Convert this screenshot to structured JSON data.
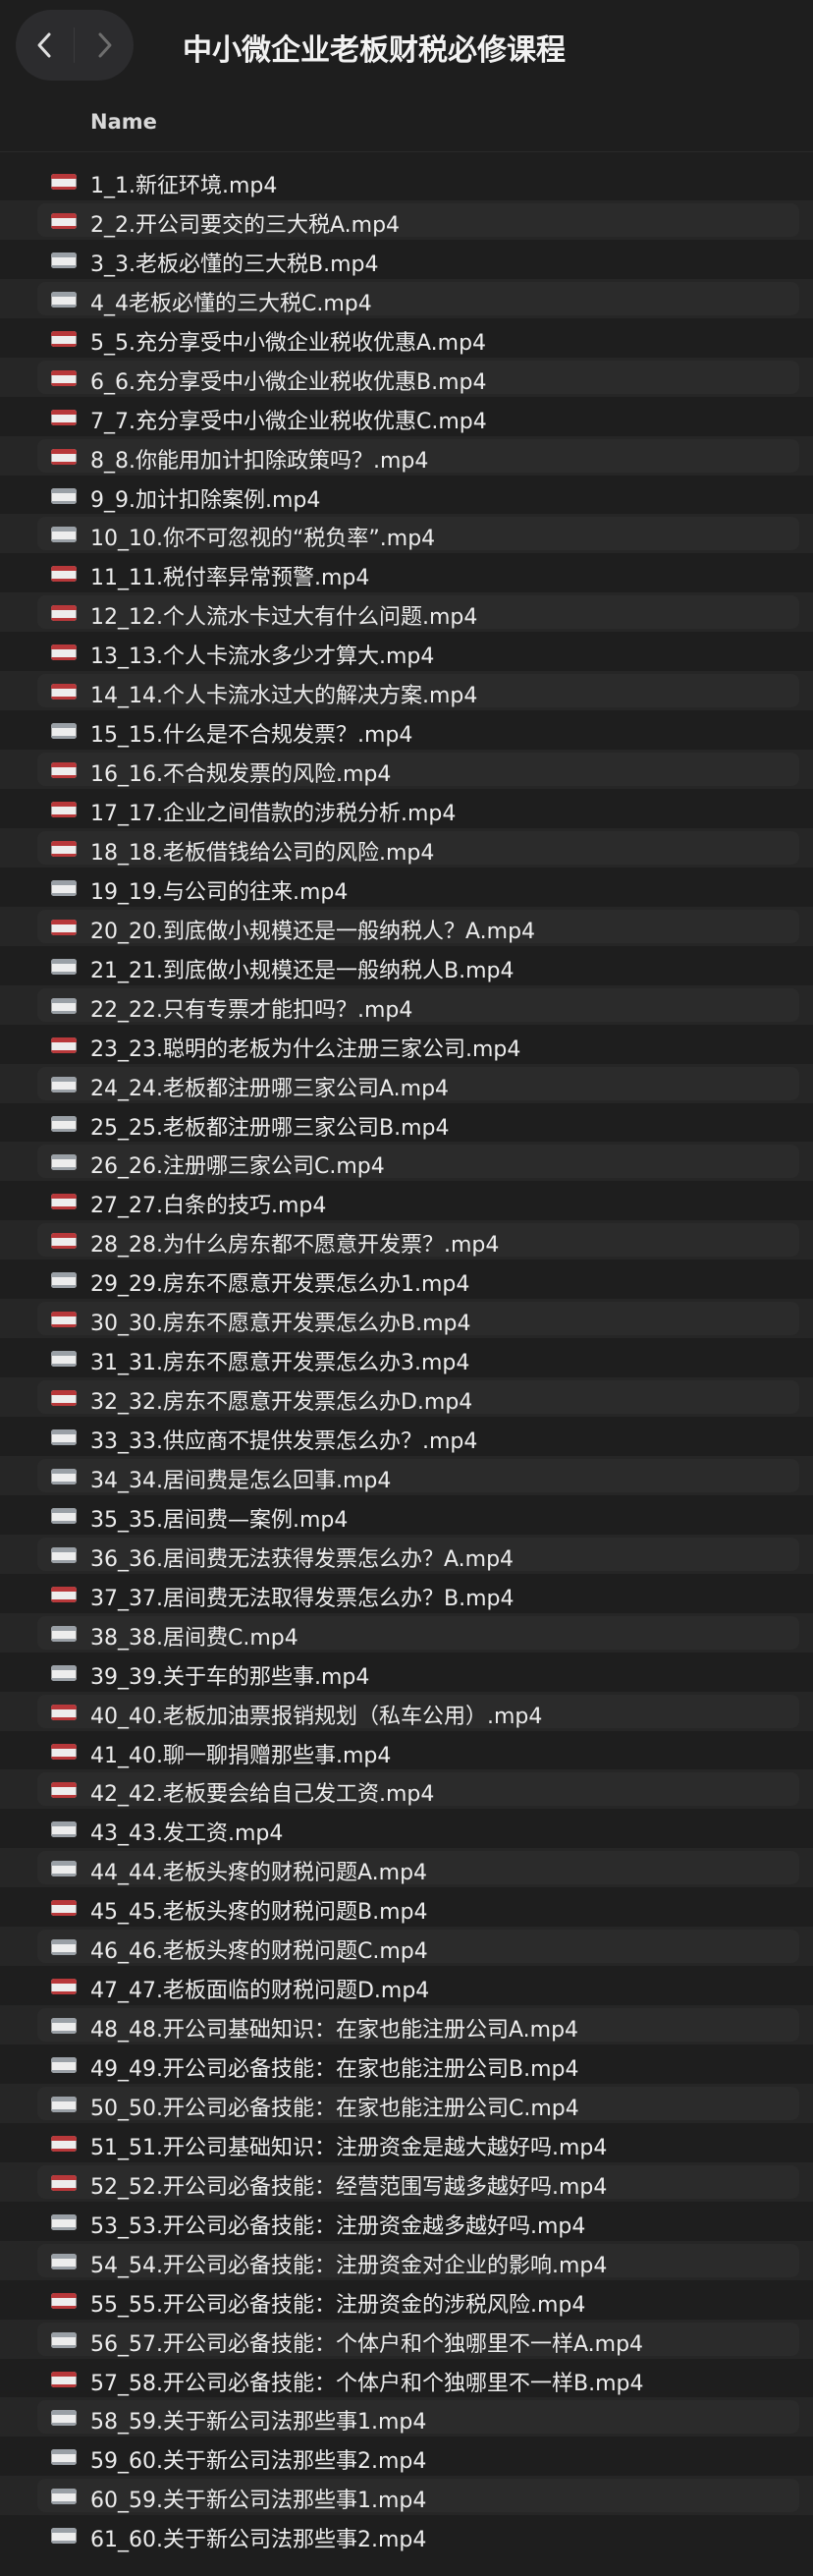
{
  "window": {
    "title": "中小微企业老板财税必修课程"
  },
  "nav": {
    "back_icon": "chevron-left-icon",
    "forward_icon": "chevron-right-icon"
  },
  "columns": {
    "name": "Name"
  },
  "files": [
    {
      "name": "1_1.新征环境.mp4",
      "icon": "video-file-icon"
    },
    {
      "name": "2_2.开公司要交的三大税A.mp4",
      "icon": "video-file-icon"
    },
    {
      "name": "3_3.老板必懂的三大税B.mp4",
      "icon": "video-file-icon"
    },
    {
      "name": "4_4老板必懂的三大税C.mp4",
      "icon": "video-file-icon"
    },
    {
      "name": "5_5.充分享受中小微企业税收优惠A.mp4",
      "icon": "video-file-icon"
    },
    {
      "name": "6_6.充分享受中小微企业税收优惠B.mp4",
      "icon": "video-file-icon"
    },
    {
      "name": "7_7.充分享受中小微企业税收优惠C.mp4",
      "icon": "video-file-icon"
    },
    {
      "name": "8_8.你能用加计扣除政策吗？.mp4",
      "icon": "video-file-icon"
    },
    {
      "name": "9_9.加计扣除案例.mp4",
      "icon": "video-file-icon"
    },
    {
      "name": "10_10.你不可忽视的“税负率”.mp4",
      "icon": "video-file-icon"
    },
    {
      "name": "11_11.税付率异常预警.mp4",
      "icon": "video-file-icon"
    },
    {
      "name": "12_12.个人流水卡过大有什么问题.mp4",
      "icon": "video-file-icon"
    },
    {
      "name": "13_13.个人卡流水多少才算大.mp4",
      "icon": "video-file-icon"
    },
    {
      "name": "14_14.个人卡流水过大的解决方案.mp4",
      "icon": "video-file-icon"
    },
    {
      "name": "15_15.什么是不合规发票？.mp4",
      "icon": "video-file-icon"
    },
    {
      "name": "16_16.不合规发票的风险.mp4",
      "icon": "video-file-icon"
    },
    {
      "name": "17_17.企业之间借款的涉税分析.mp4",
      "icon": "video-file-icon"
    },
    {
      "name": "18_18.老板借钱给公司的风险.mp4",
      "icon": "video-file-icon"
    },
    {
      "name": "19_19.与公司的往来.mp4",
      "icon": "video-file-icon"
    },
    {
      "name": "20_20.到底做小规模还是一般纳税人？A.mp4",
      "icon": "video-file-icon"
    },
    {
      "name": "21_21.到底做小规模还是一般纳税人B.mp4",
      "icon": "video-file-icon"
    },
    {
      "name": "22_22.只有专票才能扣吗？.mp4",
      "icon": "video-file-icon"
    },
    {
      "name": "23_23.聪明的老板为什么注册三家公司.mp4",
      "icon": "video-file-icon"
    },
    {
      "name": "24_24.老板都注册哪三家公司A.mp4",
      "icon": "video-file-icon"
    },
    {
      "name": "25_25.老板都注册哪三家公司B.mp4",
      "icon": "video-file-icon"
    },
    {
      "name": "26_26.注册哪三家公司C.mp4",
      "icon": "video-file-icon"
    },
    {
      "name": "27_27.白条的技巧.mp4",
      "icon": "video-file-icon"
    },
    {
      "name": "28_28.为什么房东都不愿意开发票？.mp4",
      "icon": "video-file-icon"
    },
    {
      "name": "29_29.房东不愿意开发票怎么办1.mp4",
      "icon": "video-file-icon"
    },
    {
      "name": "30_30.房东不愿意开发票怎么办B.mp4",
      "icon": "video-file-icon"
    },
    {
      "name": "31_31.房东不愿意开发票怎么办3.mp4",
      "icon": "video-file-icon"
    },
    {
      "name": "32_32.房东不愿意开发票怎么办D.mp4",
      "icon": "video-file-icon"
    },
    {
      "name": "33_33.供应商不提供发票怎么办？.mp4",
      "icon": "video-file-icon"
    },
    {
      "name": "34_34.居间费是怎么回事.mp4",
      "icon": "video-file-icon"
    },
    {
      "name": "35_35.居间费—案例.mp4",
      "icon": "video-file-icon"
    },
    {
      "name": "36_36.居间费无法获得发票怎么办？A.mp4",
      "icon": "video-file-icon"
    },
    {
      "name": "37_37.居间费无法取得发票怎么办？B.mp4",
      "icon": "video-file-icon"
    },
    {
      "name": "38_38.居间费C.mp4",
      "icon": "video-file-icon"
    },
    {
      "name": "39_39.关于车的那些事.mp4",
      "icon": "video-file-icon"
    },
    {
      "name": "40_40.老板加油票报销规划（私车公用）.mp4",
      "icon": "video-file-icon"
    },
    {
      "name": "41_40.聊一聊捐赠那些事.mp4",
      "icon": "video-file-icon"
    },
    {
      "name": "42_42.老板要会给自己发工资.mp4",
      "icon": "video-file-icon"
    },
    {
      "name": "43_43.发工资.mp4",
      "icon": "video-file-icon"
    },
    {
      "name": "44_44.老板头疼的财税问题A.mp4",
      "icon": "video-file-icon"
    },
    {
      "name": "45_45.老板头疼的财税问题B.mp4",
      "icon": "video-file-icon"
    },
    {
      "name": "46_46.老板头疼的财税问题C.mp4",
      "icon": "video-file-icon"
    },
    {
      "name": "47_47.老板面临的财税问题D.mp4",
      "icon": "video-file-icon"
    },
    {
      "name": "48_48.开公司基础知识：在家也能注册公司A.mp4",
      "icon": "video-file-icon"
    },
    {
      "name": "49_49.开公司必备技能：在家也能注册公司B.mp4",
      "icon": "video-file-icon"
    },
    {
      "name": "50_50.开公司必备技能：在家也能注册公司C.mp4",
      "icon": "video-file-icon"
    },
    {
      "name": "51_51.开公司基础知识：注册资金是越大越好吗.mp4",
      "icon": "video-file-icon"
    },
    {
      "name": "52_52.开公司必备技能：经营范围写越多越好吗.mp4",
      "icon": "video-file-icon"
    },
    {
      "name": "53_53.开公司必备技能：注册资金越多越好吗.mp4",
      "icon": "video-file-icon"
    },
    {
      "name": "54_54.开公司必备技能：注册资金对企业的影响.mp4",
      "icon": "video-file-icon"
    },
    {
      "name": "55_55.开公司必备技能：注册资金的涉税风险.mp4",
      "icon": "video-file-icon"
    },
    {
      "name": "56_57.开公司必备技能：个体户和个独哪里不一样A.mp4",
      "icon": "video-file-icon"
    },
    {
      "name": "57_58.开公司必备技能：个体户和个独哪里不一样B.mp4",
      "icon": "video-file-icon"
    },
    {
      "name": "58_59.关于新公司法那些事1.mp4",
      "icon": "video-file-icon"
    },
    {
      "name": "59_60.关于新公司法那些事2.mp4",
      "icon": "video-file-icon"
    },
    {
      "name": "60_59.关于新公司法那些事1.mp4",
      "icon": "video-file-icon"
    },
    {
      "name": "61_60.关于新公司法那些事2.mp4",
      "icon": "video-file-icon"
    }
  ]
}
